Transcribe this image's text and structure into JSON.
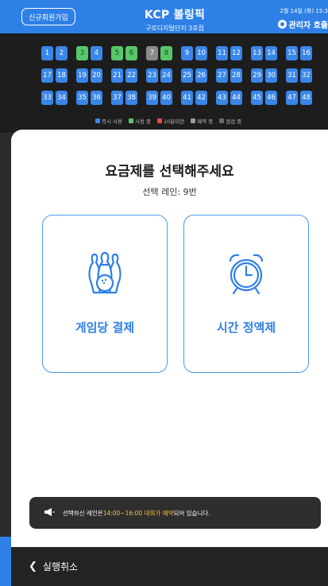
{
  "header": {
    "signup_label": "신규회원가입",
    "brand": "KCP 볼링픽",
    "location": "구로디지털단지 3호점",
    "datetime": "2월 14일 (화) 15:3",
    "admin_call": "관리자 호출"
  },
  "lanes": {
    "rows": [
      [
        {
          "n": "1",
          "s": "blue"
        },
        {
          "n": "2",
          "s": "blue"
        },
        {
          "n": "3",
          "s": "green"
        },
        {
          "n": "4",
          "s": "blue"
        },
        {
          "n": "5",
          "s": "green"
        },
        {
          "n": "6",
          "s": "green"
        },
        {
          "n": "7",
          "s": "gray"
        },
        {
          "n": "8",
          "s": "green"
        },
        {
          "n": "9",
          "s": "blue"
        },
        {
          "n": "10",
          "s": "blue"
        },
        {
          "n": "11",
          "s": "blue"
        },
        {
          "n": "12",
          "s": "blue"
        },
        {
          "n": "13",
          "s": "blue"
        },
        {
          "n": "14",
          "s": "blue"
        },
        {
          "n": "15",
          "s": "blue"
        },
        {
          "n": "16",
          "s": "blue"
        }
      ],
      [
        {
          "n": "17",
          "s": "blue"
        },
        {
          "n": "18",
          "s": "blue"
        },
        {
          "n": "19",
          "s": "blue"
        },
        {
          "n": "20",
          "s": "blue"
        },
        {
          "n": "21",
          "s": "blue"
        },
        {
          "n": "22",
          "s": "blue"
        },
        {
          "n": "23",
          "s": "blue"
        },
        {
          "n": "24",
          "s": "blue"
        },
        {
          "n": "25",
          "s": "blue"
        },
        {
          "n": "26",
          "s": "blue"
        },
        {
          "n": "27",
          "s": "blue"
        },
        {
          "n": "28",
          "s": "blue"
        },
        {
          "n": "29",
          "s": "blue"
        },
        {
          "n": "30",
          "s": "blue"
        },
        {
          "n": "31",
          "s": "blue"
        },
        {
          "n": "32",
          "s": "blue"
        }
      ],
      [
        {
          "n": "33",
          "s": "blue"
        },
        {
          "n": "34",
          "s": "blue"
        },
        {
          "n": "35",
          "s": "blue"
        },
        {
          "n": "36",
          "s": "blue"
        },
        {
          "n": "37",
          "s": "blue"
        },
        {
          "n": "38",
          "s": "blue"
        },
        {
          "n": "39",
          "s": "blue"
        },
        {
          "n": "40",
          "s": "blue"
        },
        {
          "n": "41",
          "s": "blue"
        },
        {
          "n": "42",
          "s": "blue"
        },
        {
          "n": "43",
          "s": "blue"
        },
        {
          "n": "44",
          "s": "blue"
        },
        {
          "n": "45",
          "s": "blue"
        },
        {
          "n": "46",
          "s": "blue"
        },
        {
          "n": "47",
          "s": "blue"
        },
        {
          "n": "48",
          "s": "blue"
        }
      ]
    ],
    "legend": [
      {
        "label": "즉시 사용",
        "color": "#3a86e8"
      },
      {
        "label": "사용 중",
        "color": "#57c86a"
      },
      {
        "label": "10분미만",
        "color": "#e84a4a"
      },
      {
        "label": "예약 중",
        "color": "#9a9a9a"
      },
      {
        "label": "점검 중",
        "color": "#6a6a6a"
      }
    ]
  },
  "sheet": {
    "title": "요금제를 선택해주세요",
    "selected_lane": "선택 레인: 9번",
    "option_game": "게임당 결제",
    "option_time": "시간 정액제"
  },
  "notice": {
    "prefix": "선택하신 레인은 ",
    "highlight": "14:00~16:00 대회가 예약",
    "suffix": " 되어 있습니다."
  },
  "footer": {
    "cancel_label": "실행취소"
  },
  "colors": {
    "primary": "#2f80e6",
    "available": "#3a86e8",
    "in_use": "#57c86a",
    "highlight": "#f5c33b"
  }
}
